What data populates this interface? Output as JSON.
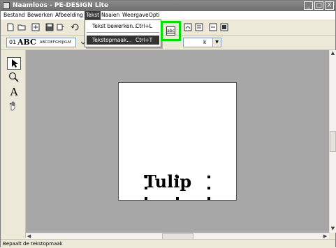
{
  "window": {
    "title": "Naamloos - PE-DESIGN Lite",
    "controls": [
      "_",
      "□",
      "X"
    ]
  },
  "menubar": {
    "items": [
      "Bestand",
      "Bewerken",
      "Afbeelding",
      "Tekst",
      "Naaien",
      "Weergave",
      "Opti"
    ]
  },
  "text_menu": {
    "items": [
      {
        "label": "Tekst bewerken...",
        "shortcut": "Ctrl+L"
      },
      {
        "label": "Tekstopmaak...",
        "shortcut": "Ctrl+T"
      }
    ],
    "highlighted_button_label": "abc"
  },
  "toolbar2": {
    "font_number": "01",
    "font_sample": "ABC",
    "font_small_sample": "ABCDEFGHIJKLM",
    "alignment_value": "k"
  },
  "canvas": {
    "text": "Tulip"
  },
  "statusbar": {
    "text": "Bepaalt de tekstopmaak"
  },
  "colors": {
    "highlight": "#00e000",
    "canvas_bg": "#a7a7a7",
    "titlebar": "#7a7a7a"
  }
}
